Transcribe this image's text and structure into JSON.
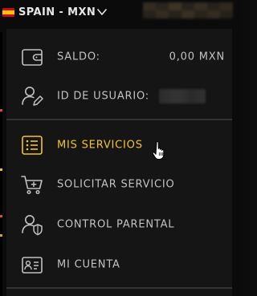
{
  "header": {
    "region_label": "SPAIN - MXN",
    "flag_icon": "spain-flag-icon",
    "chevron_icon": "chevron-down-icon"
  },
  "account": {
    "balance_label": "SALDO:",
    "balance_value": "0,00 MXN",
    "user_id_label": "ID DE USUARIO:"
  },
  "menu": {
    "items": [
      {
        "label": "MIS SERVICIOS",
        "icon": "list-icon",
        "active": true
      },
      {
        "label": "SOLICITAR SERVICIO",
        "icon": "cart-add-icon",
        "active": false
      },
      {
        "label": "CONTROL PARENTAL",
        "icon": "user-shield-icon",
        "active": false
      },
      {
        "label": "MI CUENTA",
        "icon": "id-card-icon",
        "active": false
      }
    ]
  },
  "colors": {
    "accent": "#f4c430",
    "text": "#c2c2c2",
    "panel_bg": "#151515",
    "divider": "#333333",
    "flag_red": "#c60b1e",
    "flag_yellow": "#ffc400"
  }
}
